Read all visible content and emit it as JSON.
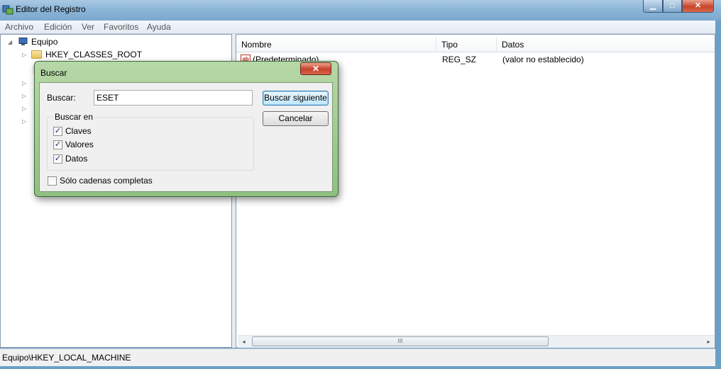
{
  "window": {
    "title": "Editor del Registro",
    "buttons": {
      "minimize": "▁",
      "maximize": "□",
      "close": "✕"
    }
  },
  "menu": [
    "Archivo",
    "Edición",
    "Ver",
    "Favoritos",
    "Ayuda"
  ],
  "tree": {
    "root": "Equipo",
    "items": [
      "HKEY_CLASSES_ROOT"
    ]
  },
  "list": {
    "columns": [
      "Nombre",
      "Tipo",
      "Datos"
    ],
    "rows": [
      {
        "icon": "ab",
        "name": "(Predeterminado)",
        "type": "REG_SZ",
        "data": "(valor no establecido)"
      }
    ]
  },
  "scrollbar": {
    "left": "◂",
    "right": "▸",
    "grip": "III"
  },
  "status": "Equipo\\HKEY_LOCAL_MACHINE",
  "dialog": {
    "title": "Buscar",
    "close": "✕",
    "search_label": "Buscar:",
    "search_value": "ESET",
    "find_next": "Buscar siguiente",
    "cancel": "Cancelar",
    "group_label": "Buscar en",
    "options": [
      {
        "label": "Claves",
        "checked": true
      },
      {
        "label": "Valores",
        "checked": true
      },
      {
        "label": "Datos",
        "checked": true
      }
    ],
    "whole_string": {
      "label": "Sólo cadenas completas",
      "checked": false
    }
  },
  "colors": {
    "titlebar": "#8db6d8",
    "dialog_frame": "#8fc07f",
    "close_red": "#c6422a"
  }
}
